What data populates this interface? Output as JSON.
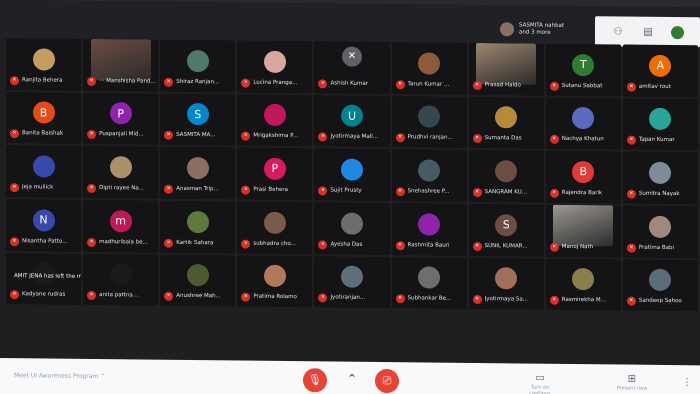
{
  "presenter": {
    "label": "SASMITA nahbat\nand 3 more"
  },
  "participants": [
    {
      "name": "Ranjita Behera",
      "initial": "",
      "color": "#c59d5f",
      "video": false
    },
    {
      "name": "··· Manshisha Pand...",
      "initial": "",
      "color": "#6d4c41",
      "video": true
    },
    {
      "name": "Shiraz Ranjan...",
      "initial": "",
      "color": "#4e7a6e",
      "video": false
    },
    {
      "name": "Lucina Pranga...",
      "initial": "",
      "color": "#d9a7a0",
      "video": false
    },
    {
      "name": "Ashish Kumar",
      "initial": "✕",
      "color": "#5f6368",
      "video": false,
      "pinned": true
    },
    {
      "name": "Tarun Kumar ...",
      "initial": "",
      "color": "#8e5a3c",
      "video": false
    },
    {
      "name": "Prasad Haldo",
      "initial": "",
      "color": "#9e8670",
      "video": true
    },
    {
      "name": "Sutanu Sabbat",
      "initial": "T",
      "color": "#2e7d32",
      "video": false
    },
    {
      "name": "amitav rout",
      "initial": "A",
      "color": "#ef6c00",
      "video": false
    },
    {
      "name": "Banita Baishak",
      "initial": "B",
      "color": "#e64a19",
      "video": false
    },
    {
      "name": "Puspanjali Mid...",
      "initial": "P",
      "color": "#8e24aa",
      "video": false
    },
    {
      "name": "SASMITA MA...",
      "initial": "S",
      "color": "#0288d1",
      "video": false
    },
    {
      "name": "Mrigakshima P...",
      "initial": "",
      "color": "#c2185b",
      "video": false
    },
    {
      "name": "Jyotirmaya Mall...",
      "initial": "U",
      "color": "#00838f",
      "video": false
    },
    {
      "name": "Prudhvi ranjan...",
      "initial": "",
      "color": "#37474f",
      "video": false
    },
    {
      "name": "Sumanta Das",
      "initial": "",
      "color": "#b58b3a",
      "video": false
    },
    {
      "name": "Nachya Khatun",
      "initial": "",
      "color": "#5c6bc0",
      "video": false
    },
    {
      "name": "Tapan Kumar",
      "initial": "",
      "color": "#26a69a",
      "video": false
    },
    {
      "name": "Jeja mullick",
      "initial": "",
      "color": "#3949ab",
      "video": false
    },
    {
      "name": "Dipti rayee Na...",
      "initial": "",
      "color": "#ad8f6a",
      "video": false
    },
    {
      "name": "Anasman Trip...",
      "initial": "",
      "color": "#8d6e63",
      "video": false
    },
    {
      "name": "Prasi Behera",
      "initial": "P",
      "color": "#d81b60",
      "video": false
    },
    {
      "name": "Sujit Prusty",
      "initial": "",
      "color": "#1e88e5",
      "video": false
    },
    {
      "name": "Snehashree P...",
      "initial": "",
      "color": "#455a64",
      "video": false
    },
    {
      "name": "SANGRAM KU...",
      "initial": "",
      "color": "#6d4c41",
      "video": false
    },
    {
      "name": "Rajendra Barik",
      "initial": "B",
      "color": "#e53935",
      "video": false
    },
    {
      "name": "Sumitra Nayak",
      "initial": "",
      "color": "#7e8b9a",
      "video": false
    },
    {
      "name": "Nisantha Patto...",
      "initial": "N",
      "color": "#3949ab",
      "video": false
    },
    {
      "name": "madhuribala be...",
      "initial": "m",
      "color": "#c2185b",
      "video": false
    },
    {
      "name": "Kartik Sahara",
      "initial": "",
      "color": "#5d7a3a",
      "video": false
    },
    {
      "name": "subhadra cho...",
      "initial": "",
      "color": "#7a5a48",
      "video": false
    },
    {
      "name": "Ayesha Das",
      "initial": "",
      "color": "#6d6d6d",
      "video": false
    },
    {
      "name": "Rashmita Bauri",
      "initial": "",
      "color": "#8e24aa",
      "video": false
    },
    {
      "name": "SUNIL KUMAR...",
      "initial": "S",
      "color": "#6d4c41",
      "video": false
    },
    {
      "name": "Manoj Nath",
      "initial": "",
      "color": "#9e9a94",
      "video": true
    },
    {
      "name": "Pratima Babi",
      "initial": "",
      "color": "#a1887f",
      "video": false
    },
    {
      "name": "Kadyane rudras",
      "initial": "",
      "color": "#1a1a1a",
      "video": false,
      "toast": "AMIT JENA has left the meeting"
    },
    {
      "name": "anita pattna...",
      "initial": "",
      "color": "#1a1a1a",
      "video": false
    },
    {
      "name": "Anushree Mah...",
      "initial": "",
      "color": "#4e5b31",
      "video": false
    },
    {
      "name": "Pratima Rolamo",
      "initial": "",
      "color": "#b07a5a",
      "video": false
    },
    {
      "name": "Jyotiranjan...",
      "initial": "",
      "color": "#5c6f7a",
      "video": false
    },
    {
      "name": "Subhankar Be...",
      "initial": "",
      "color": "#6e6e6e",
      "video": false
    },
    {
      "name": "Jyotirmaya Sa...",
      "initial": "",
      "color": "#a16f5a",
      "video": false
    },
    {
      "name": "Rasmirekha M...",
      "initial": "",
      "color": "#8a7f4a",
      "video": false
    },
    {
      "name": "Sandeep Sahoo",
      "initial": "",
      "color": "#5a6b7a",
      "video": false
    }
  ],
  "bottom": {
    "meeting_title": "Meet UI Awareness Program  ^",
    "present_label": "Present now",
    "captions_label": "Turn on captions"
  },
  "colors": {
    "end_call": "#ea4335",
    "bar_bg": "#f8f9fa"
  }
}
